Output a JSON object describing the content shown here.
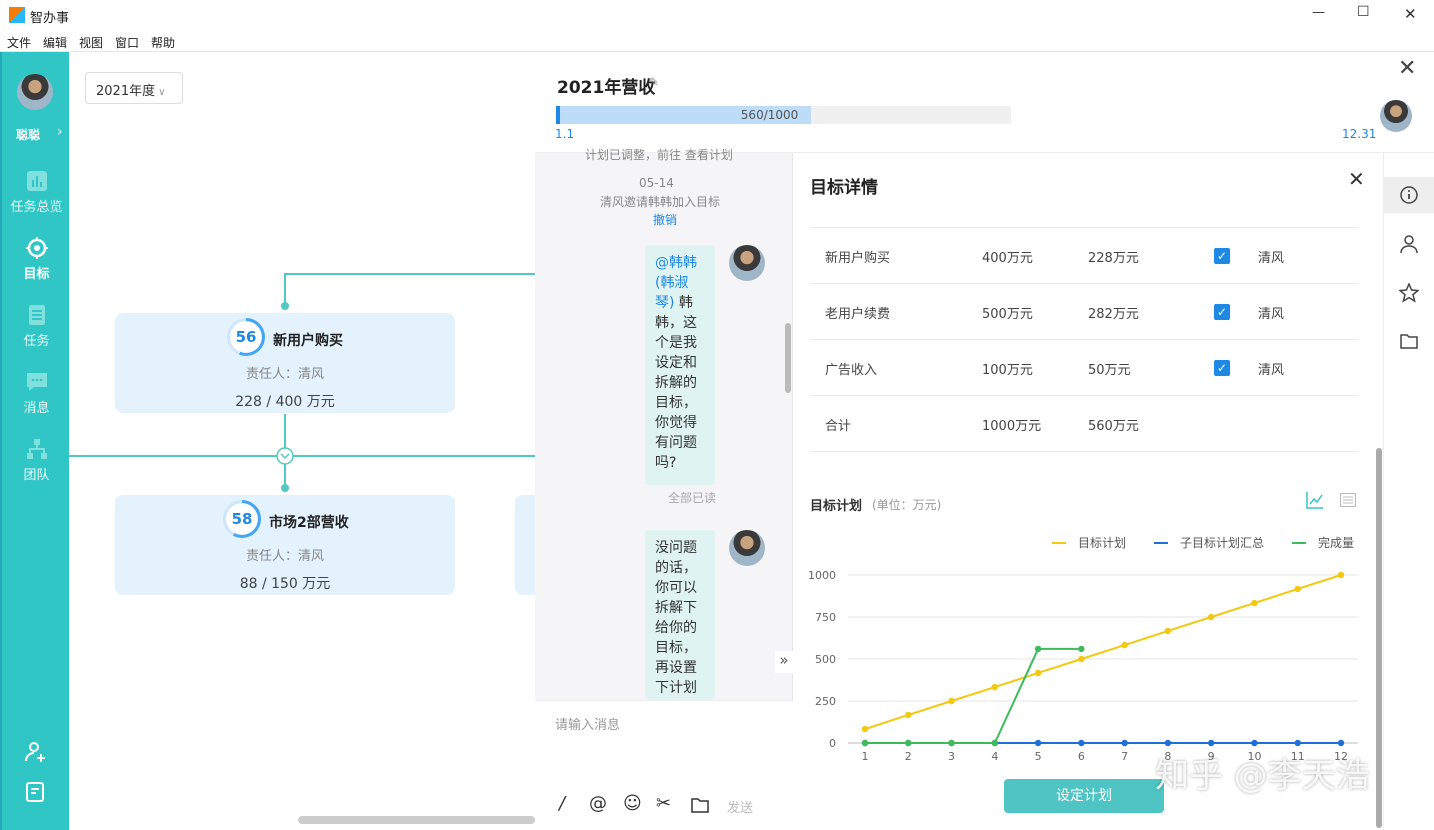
{
  "window": {
    "title": "智办事",
    "minimize": "—",
    "maximize": "☐",
    "close": "✕"
  },
  "menu": [
    "文件",
    "编辑",
    "视图",
    "窗口",
    "帮助"
  ],
  "sidebar": {
    "user": "聪聪",
    "items": [
      {
        "label": "任务总览",
        "icon": "bar-chart-icon"
      },
      {
        "label": "目标",
        "icon": "target-icon"
      },
      {
        "label": "任务",
        "icon": "list-icon"
      },
      {
        "label": "消息",
        "icon": "chat-icon"
      },
      {
        "label": "团队",
        "icon": "org-icon"
      }
    ]
  },
  "year_select": "2021年度",
  "cards": [
    {
      "score": "56",
      "title": "新用户购买",
      "owner": "责任人：清风",
      "value": "228 / 400 万元",
      "ring_pct": 56
    },
    {
      "score": "58",
      "title": "市场2部营收",
      "owner": "责任人：清风",
      "value": "88 / 150 万元",
      "ring_pct": 58
    }
  ],
  "panel": {
    "title": "2021年营收",
    "progress_label": "560/1000",
    "progress_pct": 56,
    "start": "1.1",
    "end": "12.31"
  },
  "chat": {
    "top_text": "计划已调整，前往 查看计划",
    "date": "05-14",
    "system": "清风邀请韩韩加入目标",
    "undo": "撤销",
    "msg1_mention": "@韩韩(韩淑琴)",
    "msg1": "韩韩，这个是我设定和拆解的目标，你觉得有问题吗?",
    "read": "全部已读",
    "msg2": "没问题的话，你可以拆解下给你的目标，再设置下计划",
    "input_placeholder": "请输入消息",
    "send": "发送"
  },
  "detail": {
    "title": "目标详情",
    "rows": [
      {
        "name": "新用户购买",
        "target": "400万元",
        "done": "228万元",
        "checked": true,
        "owner": "清风"
      },
      {
        "name": "老用户续费",
        "target": "500万元",
        "done": "282万元",
        "checked": true,
        "owner": "清风"
      },
      {
        "name": "广告收入",
        "target": "100万元",
        "done": "50万元",
        "checked": true,
        "owner": "清风"
      },
      {
        "name": "合计",
        "target": "1000万元",
        "done": "560万元",
        "checked": false,
        "owner": ""
      }
    ],
    "plan_title": "目标计划",
    "plan_unit": "(单位：万元)",
    "button": "设定计划"
  },
  "chart_data": {
    "type": "line",
    "x": [
      1,
      2,
      3,
      4,
      5,
      6,
      7,
      8,
      9,
      10,
      11,
      12
    ],
    "yticks": [
      0,
      250,
      500,
      750,
      1000
    ],
    "ylim": [
      0,
      1000
    ],
    "series": [
      {
        "name": "目标计划",
        "color": "#f2c811",
        "values": [
          83,
          167,
          250,
          333,
          417,
          500,
          583,
          667,
          750,
          833,
          917,
          1000
        ]
      },
      {
        "name": "子目标计划汇总",
        "color": "#1e6fd9",
        "values": [
          0,
          0,
          0,
          0,
          0,
          0,
          0,
          0,
          0,
          0,
          0,
          0
        ]
      },
      {
        "name": "完成量",
        "color": "#3dbb5b",
        "values": [
          0,
          0,
          0,
          0,
          560,
          560
        ]
      }
    ],
    "legend": "top-right"
  },
  "watermark": "知乎 @李天浩"
}
